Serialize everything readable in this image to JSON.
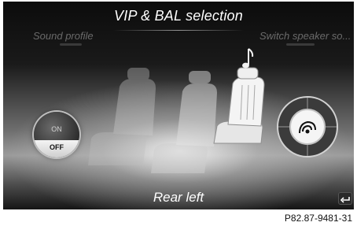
{
  "screen": {
    "title": "VIP & BAL selection",
    "menu_left_label": "Sound profile",
    "menu_right_label": "Switch speaker so...",
    "selected_seat_label": "Rear left"
  },
  "toggle": {
    "on_label": "ON",
    "off_label": "OFF",
    "selected": "OFF"
  },
  "icons": {
    "note": "music-note-icon",
    "speaker": "speaker-icon",
    "back": "back-arrow-icon"
  },
  "figure": {
    "reference": "P82.87-9481-31"
  },
  "colors": {
    "screen_top": "#0c0c0c",
    "screen_glow": "#ffffff",
    "title_text": "#ffffff",
    "menu_text": "#6a6a6a"
  }
}
